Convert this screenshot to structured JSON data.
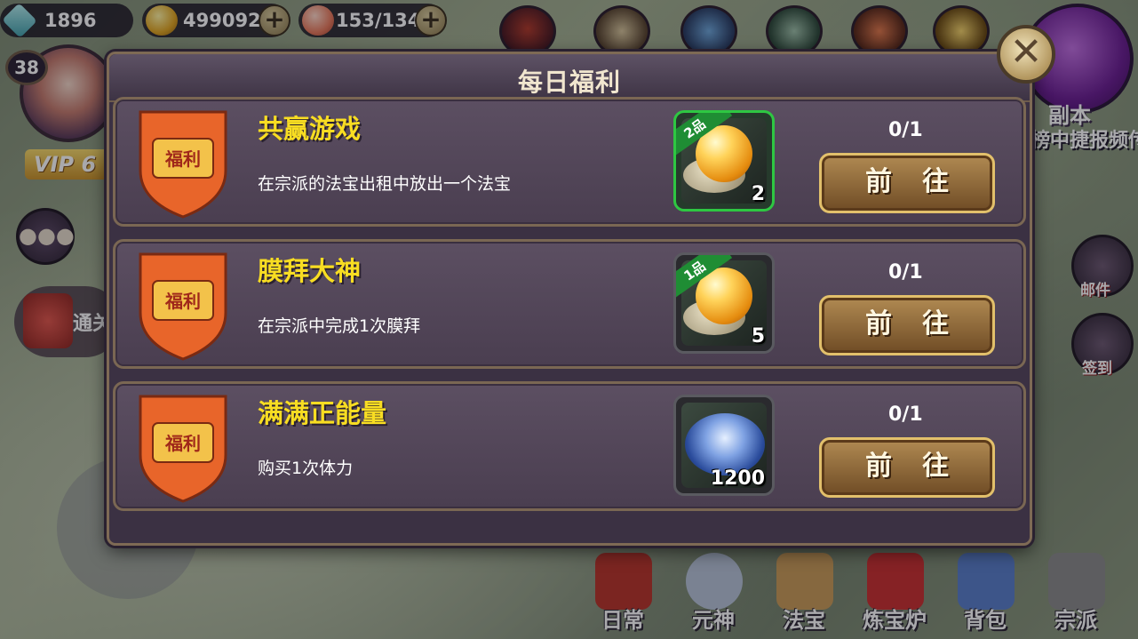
{
  "hud": {
    "gems": "1896",
    "gold": "499092",
    "stamina": "153/134",
    "level": "38",
    "vip": "VIP 6",
    "fuben_label": "副本",
    "ticker": "榜中捷报频传",
    "mail_label": "邮件",
    "signin_label": "签到",
    "clear_label": "通关"
  },
  "bottom_nav": [
    {
      "label": "日常",
      "color": "#b8352a"
    },
    {
      "label": "元神",
      "color": "#b7c4d8"
    },
    {
      "label": "法宝",
      "color": "#c99b58"
    },
    {
      "label": "炼宝炉",
      "color": "#c93030"
    },
    {
      "label": "背包",
      "color": "#5a7fc9"
    },
    {
      "label": "宗派",
      "color": "#8a8a8a"
    }
  ],
  "dialog": {
    "title": "每日福利",
    "close_icon": "close-icon",
    "tasks": [
      {
        "badge": "福利",
        "name": "共赢游戏",
        "desc": "在宗派的法宝出租中放出一个法宝",
        "reward_grade": "2品",
        "reward_qty": "2",
        "reward_type": "golden-pearl",
        "progress": "0/1",
        "button": "前往"
      },
      {
        "badge": "福利",
        "name": "膜拜大神",
        "desc": "在宗派中完成1次膜拜",
        "reward_grade": "1品",
        "reward_qty": "5",
        "reward_type": "golden-pearl",
        "progress": "0/1",
        "button": "前往"
      },
      {
        "badge": "福利",
        "name": "满满正能量",
        "desc": "购买1次体力",
        "reward_grade": "",
        "reward_qty": "1200",
        "reward_type": "blue-plate",
        "progress": "0/1",
        "button": "前往"
      }
    ]
  },
  "colors": {
    "task_name": "#f8dd22",
    "grade_ribbon": "#1f8d34",
    "dialog_bg": "#3b3143"
  }
}
